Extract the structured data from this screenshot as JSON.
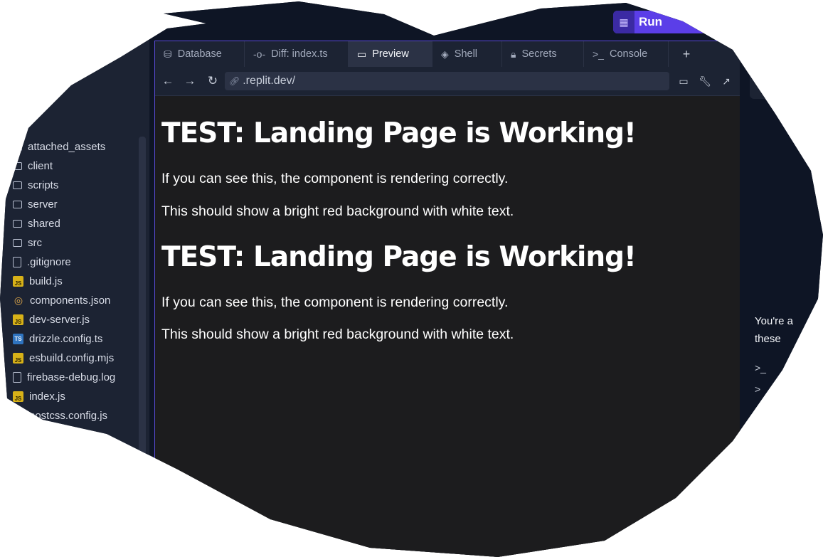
{
  "header": {
    "run_button": {
      "label": "Run",
      "icon": "run-icon"
    }
  },
  "sidebar": {
    "files": [
      {
        "name": "attached_assets",
        "type": "folder"
      },
      {
        "name": "client",
        "type": "folder"
      },
      {
        "name": "scripts",
        "type": "folder"
      },
      {
        "name": "server",
        "type": "folder"
      },
      {
        "name": "shared",
        "type": "folder"
      },
      {
        "name": "src",
        "type": "folder"
      },
      {
        "name": ".gitignore",
        "type": "file"
      },
      {
        "name": "build.js",
        "type": "js"
      },
      {
        "name": "components.json",
        "type": "json"
      },
      {
        "name": "dev-server.js",
        "type": "js"
      },
      {
        "name": "drizzle.config.ts",
        "type": "ts"
      },
      {
        "name": "esbuild.config.mjs",
        "type": "js"
      },
      {
        "name": "firebase-debug.log",
        "type": "file"
      },
      {
        "name": "index.js",
        "type": "js"
      },
      {
        "name": "postcss.config.js",
        "type": "js"
      }
    ]
  },
  "tabs": [
    {
      "label": "Database",
      "icon": "database-icon"
    },
    {
      "label": "Diff: index.ts",
      "icon": "git-diff-icon"
    },
    {
      "label": "Preview",
      "icon": "monitor-icon",
      "active": true
    },
    {
      "label": "Shell",
      "icon": "shell-icon"
    },
    {
      "label": "Secrets",
      "icon": "lock-icon"
    },
    {
      "label": "Console",
      "icon": "terminal-icon"
    }
  ],
  "urlbar": {
    "url": ".replit.dev/"
  },
  "preview": {
    "heading_1": "TEST: Landing Page is Working!",
    "para_1a": "If you can see this, the component is rendering correctly.",
    "para_1b": "This should show a bright red background with white text.",
    "heading_2": "TEST: Landing Page is Working!",
    "para_2a": "If you can see this, the component is rendering correctly.",
    "para_2b": "This should show a bright red background with white text."
  },
  "right_panel": {
    "line_1": "You're a",
    "line_2": "these"
  },
  "colors": {
    "accent": "#5b3ee8",
    "background": "#0e1525",
    "surface": "#1c2333",
    "preview_bg": "#1c1c1e"
  }
}
